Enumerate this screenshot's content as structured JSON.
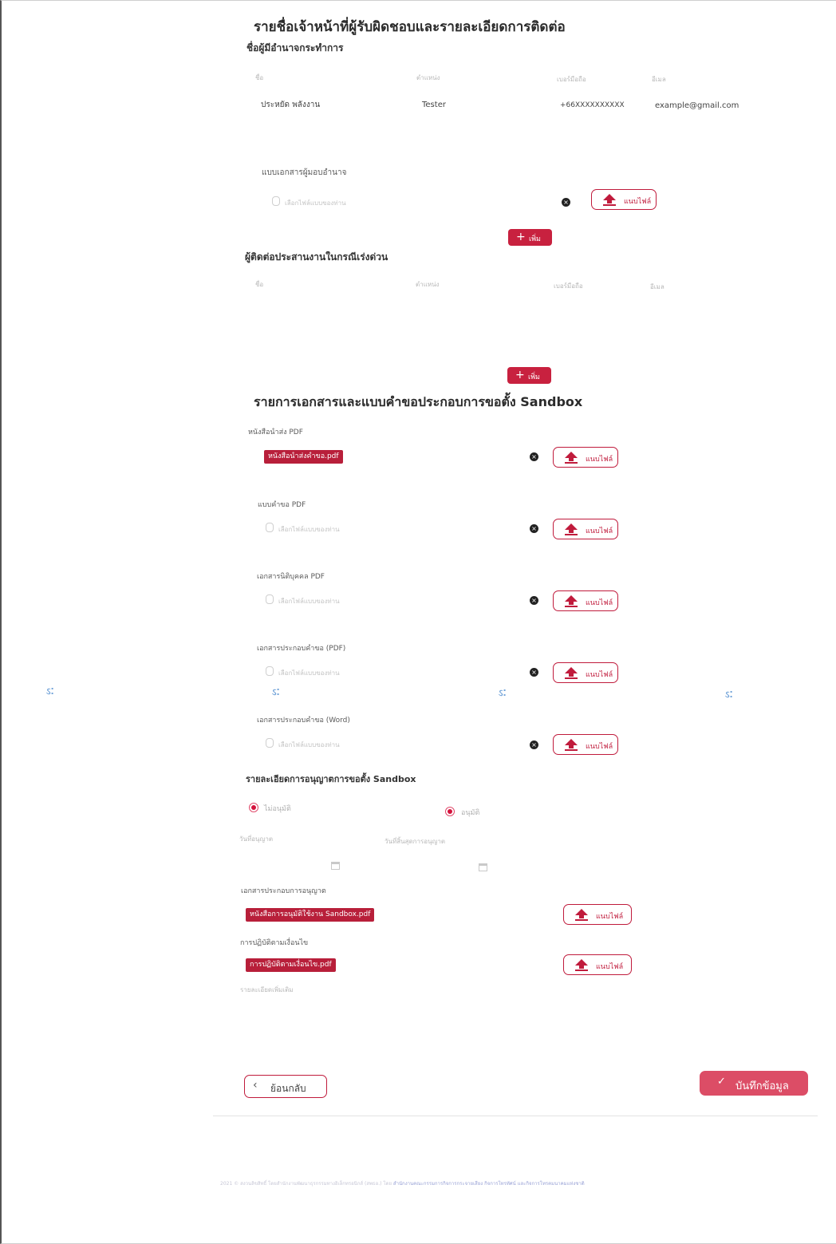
{
  "section1": {
    "title": "รายชื่อเจ้าหน้าที่ผู้รับผิดชอบและรายละเอียดการติดต่อ",
    "authorized": {
      "subtitle": "ชื่อผู้มีอำนาจกระทำการ",
      "columns": [
        "ชื่อ",
        "ตำแหน่ง",
        "เบอร์มือถือ",
        "อีเมล"
      ],
      "row": {
        "name": "ประหยัด พลังงาน",
        "position": "Tester",
        "phone": "+66XXXXXXXXXX",
        "email": "example@gmail.com"
      },
      "proxy_label": "แบบเอกสารผู้มอบอำนาจ",
      "file_placeholder": "เลือกไฟล์แบบของท่าน",
      "upload_label": "แนบไฟล์",
      "add_label": "เพิ่ม"
    },
    "urgent": {
      "subtitle": "ผู้ติดต่อประสานงานในกรณีเร่งด่วน",
      "columns": [
        "ชื่อ",
        "ตำแหน่ง",
        "เบอร์มือถือ",
        "อีเมล"
      ],
      "add_label": "เพิ่ม"
    }
  },
  "section2": {
    "title": "รายการเอกสารและแบบคำขอประกอบการขอตั้ง Sandbox",
    "docs": [
      {
        "label": "หนังสือนำส่ง PDF",
        "file": "หนังสือนำส่งคำขอ.pdf",
        "upload": "แนบไฟล์"
      },
      {
        "label": "แบบคำขอ PDF",
        "placeholder": "เลือกไฟล์แบบของท่าน",
        "upload": "แนบไฟล์"
      },
      {
        "label": "เอกสารนิติบุคคล PDF",
        "placeholder": "เลือกไฟล์แบบของท่าน",
        "upload": "แนบไฟล์"
      },
      {
        "label": "เอกสารประกอบคำขอ (PDF)",
        "placeholder": "เลือกไฟล์แบบของท่าน",
        "upload": "แนบไฟล์"
      },
      {
        "label": "เอกสารประกอบคำขอ (Word)",
        "placeholder": "เลือกไฟล์แบบของท่าน",
        "upload": "แนบไฟล์"
      }
    ]
  },
  "section3": {
    "title": "รายละเอียดการอนุญาตการขอตั้ง Sandbox",
    "radio_reject": "ไม่อนุมัติ",
    "radio_approve": "อนุมัติ",
    "start_date_label": "วันที่อนุญาต",
    "end_date_label": "วันที่สิ้นสุดการอนุญาต",
    "permit_docs_label": "เอกสารประกอบการอนุญาต",
    "permit_file": "หนังสือการอนุมัติใช้งาน Sandbox.pdf",
    "conditions_label": "การปฏิบัติตามเงื่อนไข",
    "conditions_file": "การปฏิบัติตามเงื่อนไข.pdf",
    "upload_label": "แนบไฟล์",
    "extra_label": "รายละเอียดเพิ่มเติม"
  },
  "actions": {
    "back_label": "ย้อนกลับ",
    "save_label": "บันทึกข้อมูล"
  },
  "footer": {
    "text": "2021 © สงวนลิขสิทธิ์ โดยสำนักงานพัฒนาธุรกรรมทางอิเล็กทรอนิกส์ (สพธอ.) โดย",
    "org": "สำนักงานคณะกรรมการกิจการกระจายเสียง กิจการโทรทัศน์ และกิจการโทรคมนาคมแห่งชาติ"
  },
  "colors": {
    "accent": "#c01b3c",
    "save_bg": "#dc4d66"
  }
}
